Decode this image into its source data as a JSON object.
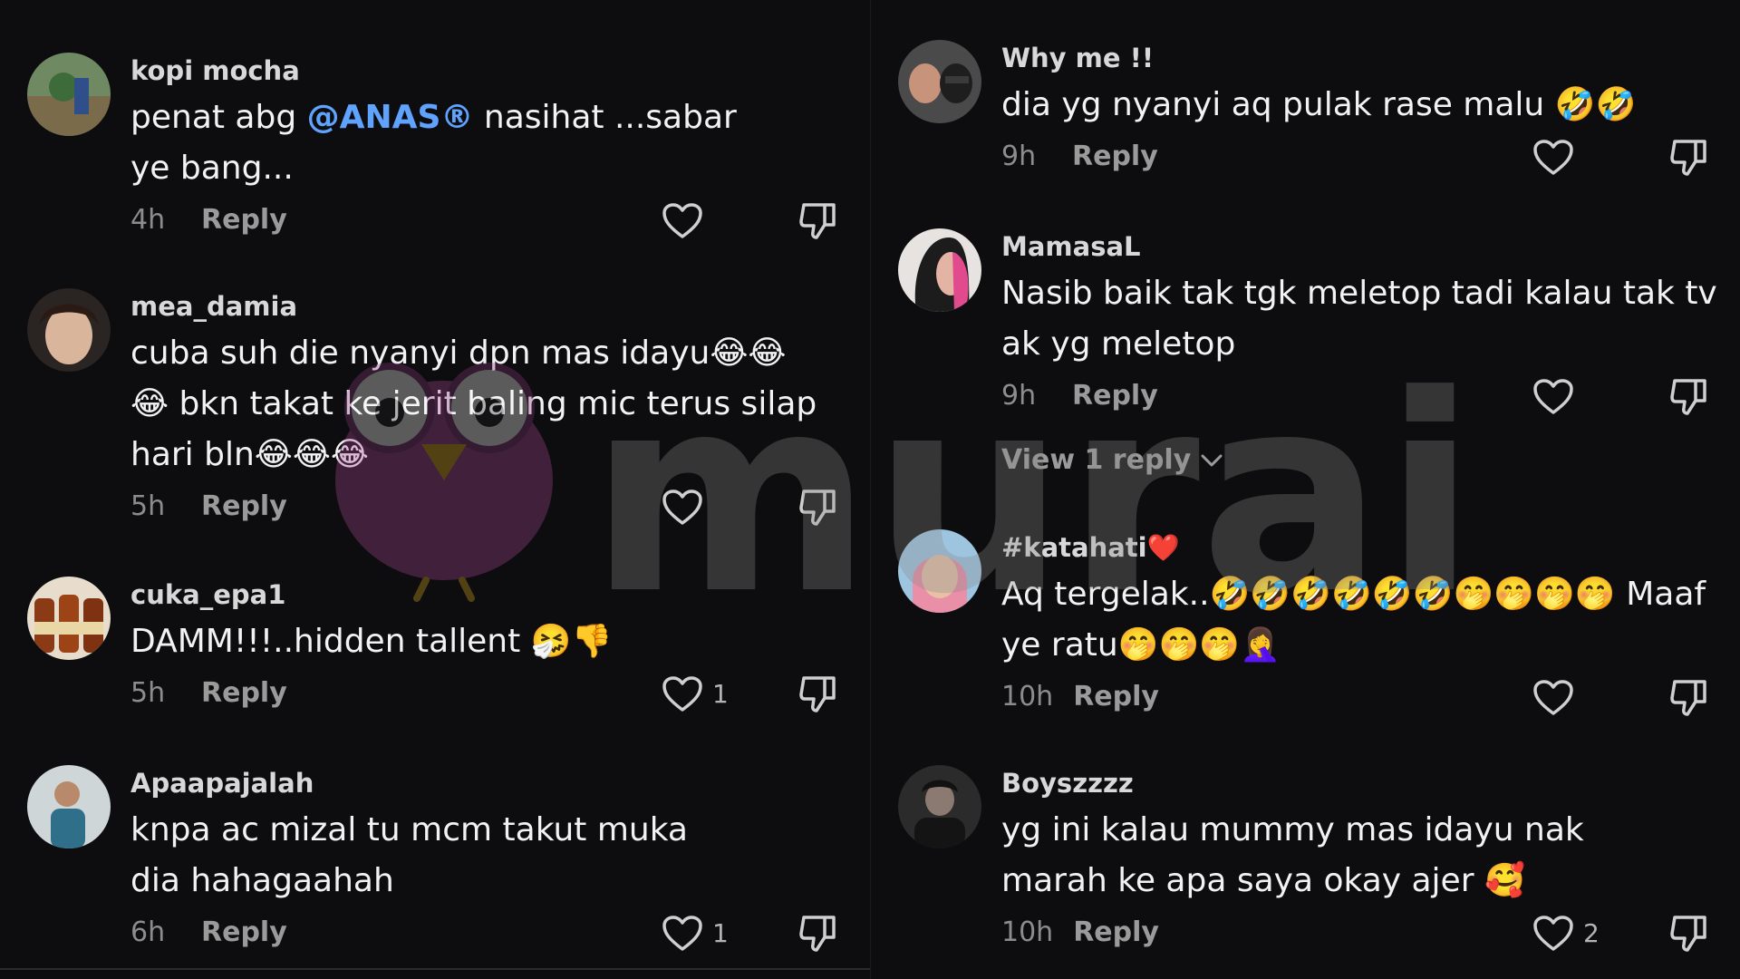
{
  "left_column": {
    "comments": [
      {
        "username": "kopi mocha",
        "text_before": "penat abg ",
        "mention": "@ANAS®",
        "text_after": " nasihat ...sabar ye bang...",
        "time": "4h",
        "reply": "Reply",
        "likes": ""
      },
      {
        "username": "mea_damia",
        "text": "cuba suh die nyanyi dpn mas idayu😂😂😂 bkn takat ke jerit baling mic terus silap hari bln😂😂😂",
        "time": "5h",
        "reply": "Reply",
        "likes": ""
      },
      {
        "username": "cuka_epa1",
        "text": "DAMM!!!..hidden tallent 🤧👎",
        "time": "5h",
        "reply": "Reply",
        "likes": "1"
      },
      {
        "username": "Apaapajalah",
        "text": "knpa ac mizal tu mcm takut muka dia hahagaahah",
        "time": "6h",
        "reply": "Reply",
        "likes": "1"
      }
    ]
  },
  "right_column": {
    "comments": [
      {
        "username": "Why me !!",
        "text": "dia yg nyanyi aq pulak rase malu 🤣🤣",
        "time": "9h",
        "reply": "Reply",
        "likes": ""
      },
      {
        "username": "MamasaL",
        "text": "Nasib baik tak tgk meletop tadi kalau tak tv ak yg meletop",
        "time": "9h",
        "reply": "Reply",
        "likes": "",
        "view_replies": "View 1 reply"
      },
      {
        "username": "#katahati❤️",
        "text": "Aq tergelak..🤣🤣🤣🤣🤣🤣🤭🤭🤭🤭 Maaf ye ratu🤭🤭🤭🤦‍♀️",
        "time": "10h",
        "reply": "Reply",
        "likes": ""
      },
      {
        "username": "Boyszzzz",
        "text": "yg ini kalau mummy mas idayu nak marah ke apa saya okay ajer 🥰",
        "time": "10h",
        "reply": "Reply",
        "likes": "2"
      }
    ]
  },
  "watermark": {
    "text": "murai"
  },
  "colors": {
    "background": "#0d0d0f",
    "mention": "#5fa3ff",
    "watermark": "#b04a9a"
  }
}
